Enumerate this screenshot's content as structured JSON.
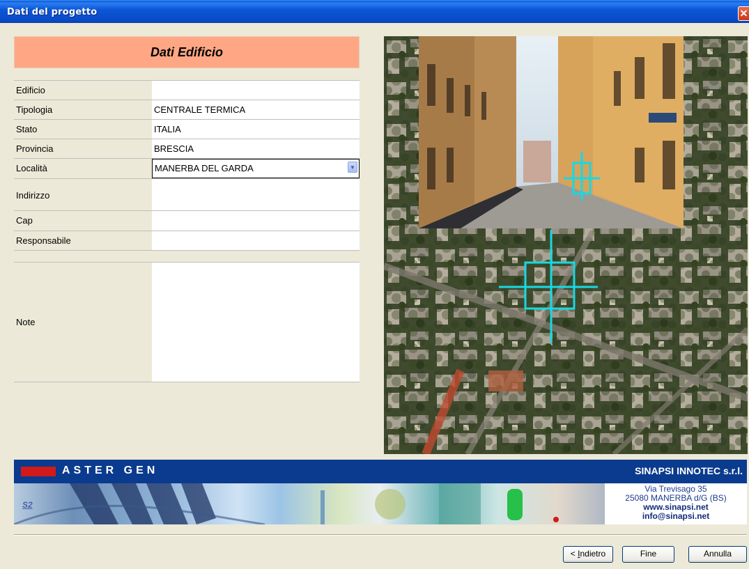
{
  "window": {
    "title": "Dati del progetto",
    "close_glyph": "✕"
  },
  "form": {
    "header": "Dati Edificio",
    "fields": [
      {
        "label": "Edificio",
        "value": ""
      },
      {
        "label": "Tipologia",
        "value": "CENTRALE TERMICA"
      },
      {
        "label": "Stato",
        "value": "ITALIA"
      },
      {
        "label": "Provincia",
        "value": "BRESCIA"
      },
      {
        "label": "Località",
        "value": "MANERBA DEL GARDA"
      },
      {
        "label": "Indirizzo",
        "value": ""
      },
      {
        "label": "Cap",
        "value": ""
      },
      {
        "label": "Responsabile",
        "value": ""
      },
      {
        "label": "Note",
        "value": ""
      }
    ]
  },
  "banner": {
    "product": "ASTER GEN",
    "company": "SINAPSI INNOTEC s.r.l.",
    "logo_mark": "S2",
    "address_line1": "Via Trevisago 35",
    "address_line2": "25080 MANERBA d/G (BS)",
    "website": "www.sinapsi.net",
    "email": "info@sinapsi.net",
    "colors": {
      "bar": "#0B3B8E",
      "accent": "#D11A1A"
    }
  },
  "buttons": {
    "back_prefix": "< ",
    "back_mnemonic": "I",
    "back_rest": "ndietro",
    "finish": "Fine",
    "cancel": "Annulla"
  },
  "icons": {
    "dropdown": "chevron-down-icon",
    "close": "close-icon"
  }
}
